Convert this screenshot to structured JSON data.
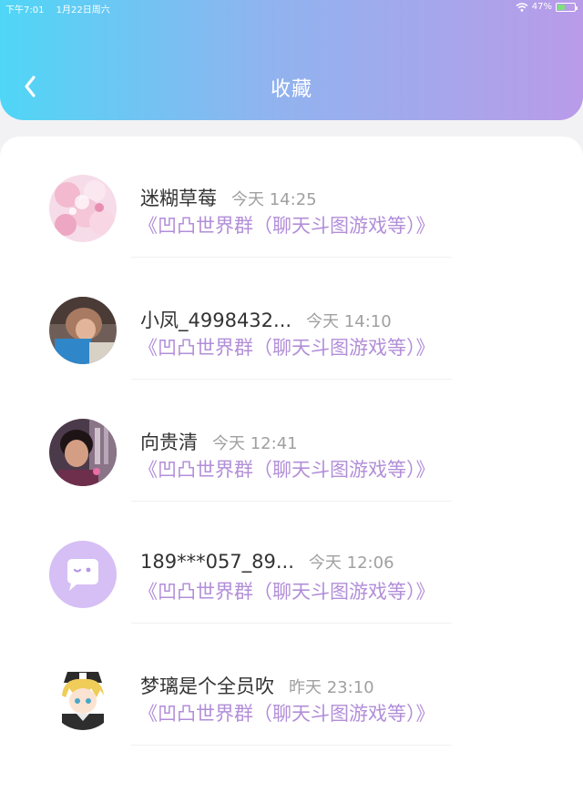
{
  "status_bar": {
    "time": "下午7:01",
    "date": "1月22日周六",
    "battery": "47%",
    "battery_level": 0.47
  },
  "header": {
    "title": "收藏",
    "back_icon": "chevron-left-icon"
  },
  "colors": {
    "header_gradient_start": "#4fd6f6",
    "header_gradient_end": "#b99be9",
    "group_link": "#b28ed8"
  },
  "favorites": [
    {
      "name": "迷糊草莓",
      "time": "今天 14:25",
      "group": "《凹凸世界群（聊天斗图游戏等）》",
      "avatar": "pink-floral-avatar"
    },
    {
      "name": "小凤_4998432...",
      "time": "今天 14:10",
      "group": "《凹凸世界群（聊天斗图游戏等）》",
      "avatar": "photo-avatar"
    },
    {
      "name": "向贵清",
      "time": "今天 12:41",
      "group": "《凹凸世界群（聊天斗图游戏等）》",
      "avatar": "photo-avatar"
    },
    {
      "name": "189***057_89...",
      "time": "今天 12:06",
      "group": "《凹凸世界群（聊天斗图游戏等）》",
      "avatar": "default-chat-avatar"
    },
    {
      "name": "梦璃是个全员吹",
      "time": "昨天 23:10",
      "group": "《凹凸世界群（聊天斗图游戏等）》",
      "avatar": "anime-avatar"
    }
  ]
}
